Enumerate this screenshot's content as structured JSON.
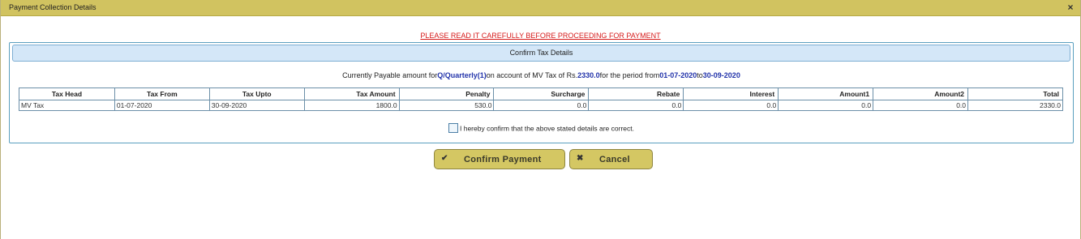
{
  "dialog": {
    "title": "Payment Collection Details",
    "close_icon": "×"
  },
  "notice": "PLEASE READ IT CAREFULLY BEFORE PROCEEDING FOR PAYMENT",
  "panel": {
    "header": "Confirm Tax Details",
    "payable": {
      "prefix": "Currently Payable amount for",
      "mode": "Q/Quarterly(1)",
      "middle": "on account of MV Tax of Rs.",
      "amount": "2330.0",
      "period_text": "for the period from",
      "from": "01-07-2020",
      "to_text": "to",
      "to": "30-09-2020"
    },
    "table": {
      "headers": [
        "Tax Head",
        "Tax From",
        "Tax Upto",
        "Tax Amount",
        "Penalty",
        "Surcharge",
        "Rebate",
        "Interest",
        "Amount1",
        "Amount2",
        "Total"
      ],
      "row": [
        "MV Tax",
        "01-07-2020",
        "30-09-2020",
        "1800.0",
        "530.0",
        "0.0",
        "0.0",
        "0.0",
        "0.0",
        "0.0",
        "2330.0"
      ]
    },
    "confirm_text": "I hereby confirm that the above stated details are correct."
  },
  "buttons": {
    "confirm": "Confirm Payment",
    "confirm_icon": "✔",
    "cancel": "Cancel",
    "cancel_icon": "✖"
  },
  "colors": {
    "titlebar": "#d1c360",
    "notice": "#d61a1a",
    "panel_border": "#5a9fbf",
    "panel_header_bg": "#d4e7f8",
    "highlight": "#2233aa",
    "button_bg": "#d4c763"
  }
}
